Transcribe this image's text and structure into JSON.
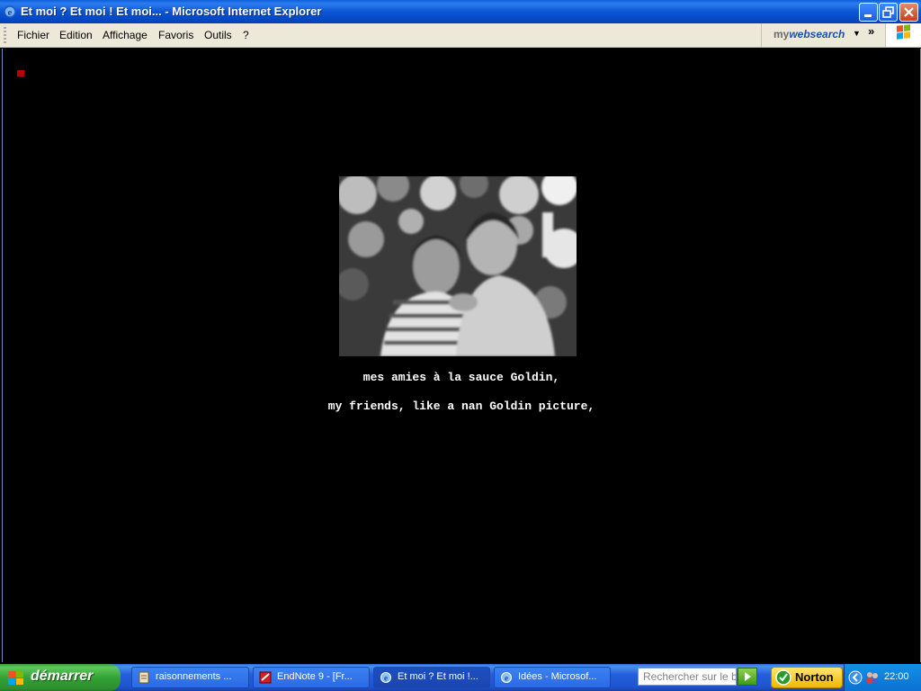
{
  "window": {
    "title": "Et moi ? Et moi ! Et moi... - Microsoft Internet Explorer"
  },
  "menu": {
    "items": [
      "Fichier",
      "Edition",
      "Affichage",
      "Favoris",
      "Outils",
      "?"
    ],
    "mywebsearch_prefix": "my",
    "mywebsearch_brand": "websearch"
  },
  "page": {
    "caption_fr": "mes amies à la sauce Goldin,",
    "caption_en": "my friends, like a nan Goldin picture,",
    "photo": {
      "alt": "black and white photo of two women",
      "style": "grayscale"
    }
  },
  "taskbar": {
    "start_label": "démarrer",
    "tasks": [
      {
        "label": "raisonnements ...",
        "icon": "document-icon"
      },
      {
        "label": "EndNote 9 - [Fr...",
        "icon": "endnote-icon"
      },
      {
        "label": "Et moi ? Et moi !...",
        "icon": "ie-icon",
        "active": true
      },
      {
        "label": "Idées - Microsof...",
        "icon": "ie-icon"
      }
    ],
    "search_placeholder": "Rechercher sur le bur",
    "norton_label": "Norton",
    "clock": "22:00"
  },
  "colors": {
    "titlebar": "#0b56d4",
    "page_background": "#000000",
    "caption_text": "#ffffff",
    "marker": "#bb0000",
    "start_button": "#34a234"
  }
}
